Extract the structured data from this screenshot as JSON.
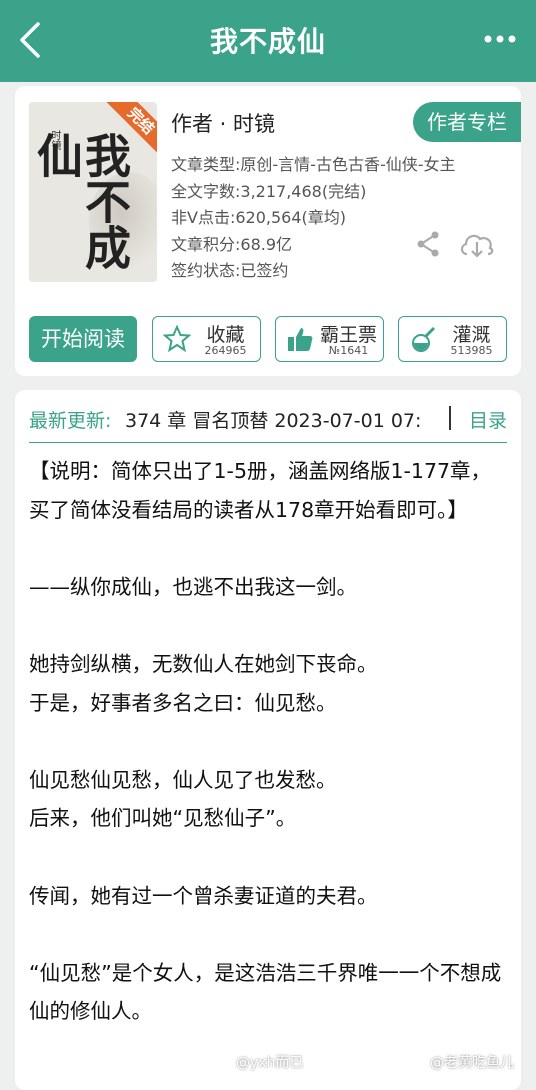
{
  "header": {
    "title": "我不成仙",
    "back_icon": "chevron-left-icon",
    "more_icon": "more-dots-icon"
  },
  "book": {
    "cover": {
      "ribbon": "完结",
      "title": "我不成仙",
      "author": "时镜"
    },
    "author_line": "作者 · 时镜",
    "author_button": "作者专栏",
    "meta": [
      "文章类型:原创-言情-古色古香-仙侠-女主",
      "全文字数:3,217,468(完结)",
      "非V点击:620,564(章均)",
      "文章积分:68.9亿",
      "签约状态:已签约"
    ],
    "actions": {
      "read": "开始阅读",
      "favorite": {
        "label": "收藏",
        "count": "264965"
      },
      "vote": {
        "label": "霸王票",
        "count": "№1641"
      },
      "water": {
        "label": "灌溉",
        "count": "513985"
      }
    }
  },
  "update": {
    "label": "最新更新:",
    "text": "374 章 冒名顶替 2023-07-01 07:",
    "toc": "目录"
  },
  "intro": [
    "【说明：简体只出了1-5册，涵盖网络版1-177章，买了简体没看结局的读者从178章开始看即可。】",
    "",
    "——纵你成仙，也逃不出我这一剑。",
    "",
    "她持剑纵横，无数仙人在她剑下丧命。",
    "于是，好事者多名之曰：仙见愁。",
    "",
    "仙见愁仙见愁，仙人见了也发愁。",
    "后来，他们叫她“见愁仙子”。",
    "",
    "传闻，她有过一个曾杀妻证道的夫君。",
    "",
    "“仙见愁”是个女人，是这浩浩三千界唯一一个不想成仙的修仙人。"
  ],
  "watermarks": [
    "@yxh而已",
    "@老黄吃鱼儿"
  ],
  "colors": {
    "brand": "#3aa389",
    "ribbon": "#e66a2c"
  }
}
